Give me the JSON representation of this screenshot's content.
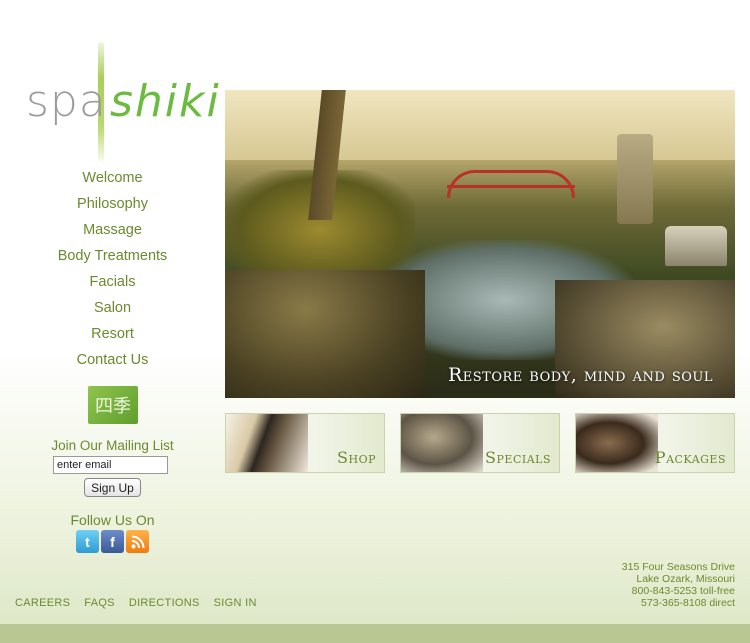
{
  "logo": {
    "spa": "spa",
    "shiki": "shiki"
  },
  "nav": [
    "Welcome",
    "Philosophy",
    "Massage",
    "Body Treatments",
    "Facials",
    "Salon",
    "Resort",
    "Contact Us"
  ],
  "seal": {
    "text": "四季"
  },
  "mailing": {
    "label": "Join Our Mailing List",
    "email_value": "enter email",
    "signup_label": "Sign Up"
  },
  "follow": {
    "label": "Follow Us On",
    "icons": [
      "twitter-icon",
      "facebook-icon",
      "rss-icon"
    ]
  },
  "hero": {
    "caption": "Restore body, mind and soul"
  },
  "tiles": [
    "Shop",
    "Specials",
    "Packages"
  ],
  "footer_links": [
    "CAREERS",
    "FAQS",
    "DIRECTIONS",
    "SIGN IN"
  ],
  "address": [
    "315 Four Seasons Drive",
    "Lake Ozark, Missouri",
    "800-843-5253 toll-free",
    "573-365-8108 direct"
  ],
  "colors": {
    "accent_green": "#6b8a2f",
    "logo_green": "#6bbb3f",
    "band": "#b9c794"
  }
}
